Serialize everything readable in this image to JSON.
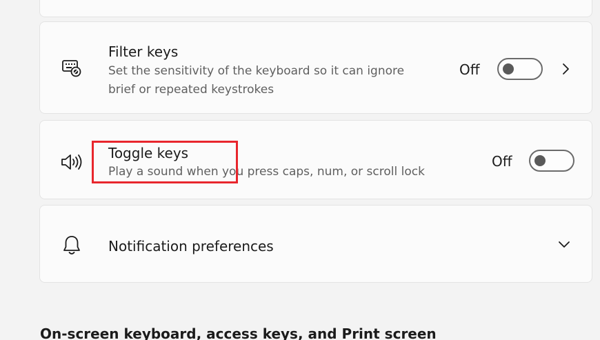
{
  "settings": {
    "filter_keys": {
      "title": "Filter keys",
      "description_line1": "Set the sensitivity of the keyboard so it can ignore",
      "description_line2": "brief or repeated keystrokes",
      "state": "Off",
      "icon": "filter-keys-icon",
      "toggle_on": false
    },
    "toggle_keys": {
      "title": "Toggle keys",
      "description": "Play a sound when you press caps, num, or scroll lock",
      "state": "Off",
      "icon": "speaker-icon",
      "toggle_on": false
    },
    "notification_preferences": {
      "title": "Notification preferences",
      "icon": "bell-icon"
    }
  },
  "section_heading": "On-screen keyboard, access keys, and Print screen",
  "colors": {
    "background": "#f3f3f3",
    "card": "#fbfbfb",
    "highlight": "#e8262d"
  }
}
